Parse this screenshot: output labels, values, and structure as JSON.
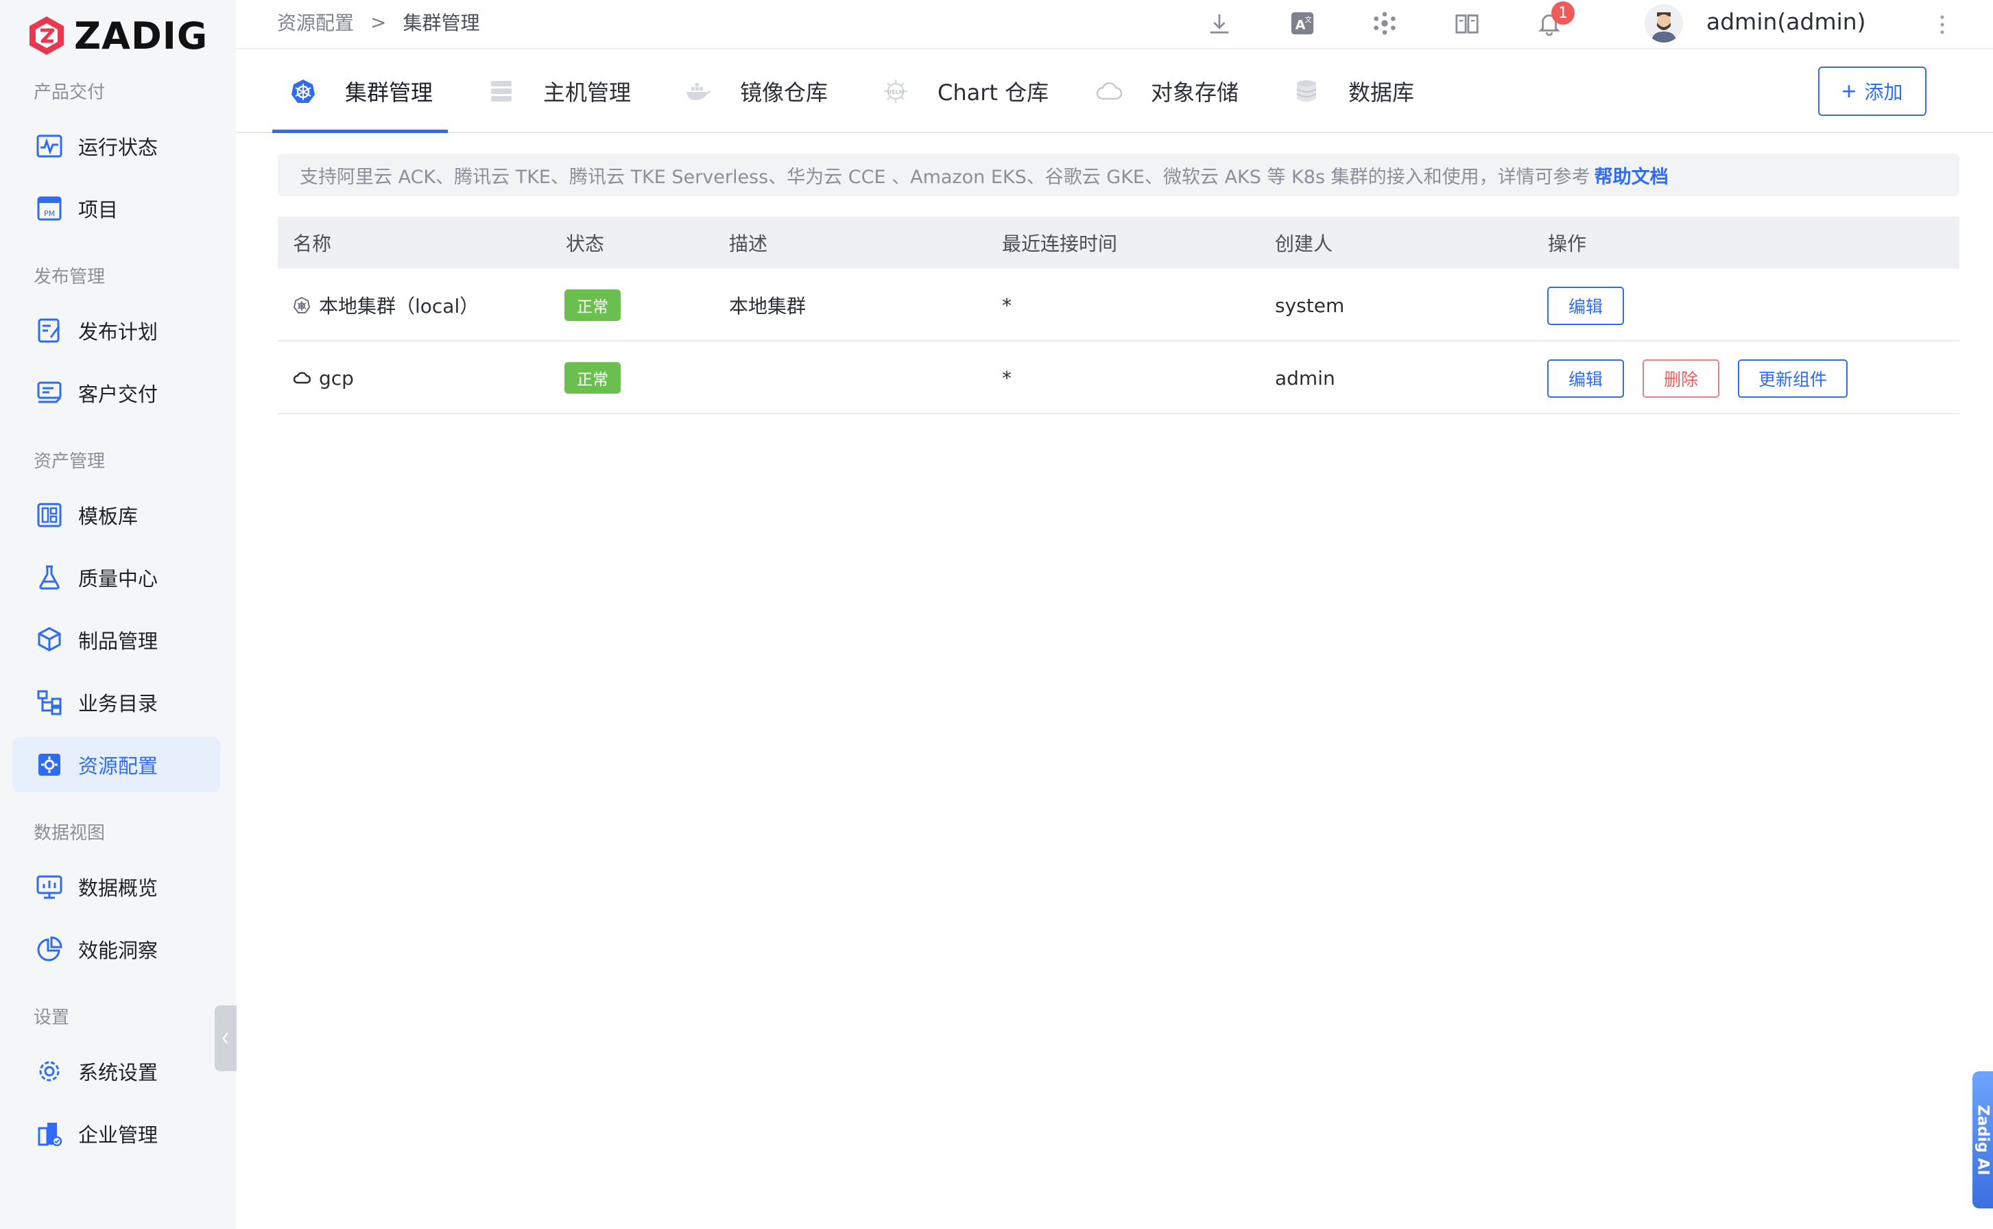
{
  "brand": {
    "name": "ZADIG"
  },
  "sidebar": {
    "sections": [
      {
        "label": "产品交付",
        "items": [
          {
            "label": "运行状态",
            "icon": "activity-monitor-icon"
          },
          {
            "label": "项目",
            "icon": "project-pm-icon"
          }
        ]
      },
      {
        "label": "发布管理",
        "items": [
          {
            "label": "发布计划",
            "icon": "release-plan-icon"
          },
          {
            "label": "客户交付",
            "icon": "customer-delivery-icon"
          }
        ]
      },
      {
        "label": "资产管理",
        "items": [
          {
            "label": "模板库",
            "icon": "template-library-icon"
          },
          {
            "label": "质量中心",
            "icon": "quality-flask-icon"
          },
          {
            "label": "制品管理",
            "icon": "artifact-package-icon"
          },
          {
            "label": "业务目录",
            "icon": "business-directory-icon"
          },
          {
            "label": "资源配置",
            "icon": "resource-config-icon"
          }
        ]
      },
      {
        "label": "数据视图",
        "items": [
          {
            "label": "数据概览",
            "icon": "data-overview-icon"
          },
          {
            "label": "效能洞察",
            "icon": "insight-pie-icon"
          }
        ]
      },
      {
        "label": "设置",
        "items": [
          {
            "label": "系统设置",
            "icon": "system-settings-icon"
          },
          {
            "label": "企业管理",
            "icon": "enterprise-icon"
          }
        ]
      }
    ],
    "active_item": "资源配置"
  },
  "header": {
    "breadcrumb": {
      "parent": "资源配置",
      "separator": ">",
      "current": "集群管理"
    },
    "notification_count": "1",
    "username": "admin(admin)"
  },
  "tabs": [
    {
      "label": "集群管理",
      "icon": "kubernetes-icon",
      "active": true
    },
    {
      "label": "主机管理",
      "icon": "server-icon",
      "active": false
    },
    {
      "label": "镜像仓库",
      "icon": "docker-icon",
      "active": false
    },
    {
      "label": "Chart 仓库",
      "icon": "helm-icon",
      "active": false
    },
    {
      "label": "对象存储",
      "icon": "cloud-storage-icon",
      "active": false
    },
    {
      "label": "数据库",
      "icon": "database-icon",
      "active": false
    }
  ],
  "add_button": {
    "label": "添加"
  },
  "notice": {
    "text": "支持阿里云 ACK、腾讯云 TKE、腾讯云 TKE Serverless、华为云 CCE 、Amazon EKS、谷歌云 GKE、微软云 AKS 等 K8s 集群的接入和使用，详情可参考",
    "link": "帮助文档"
  },
  "table": {
    "columns": [
      "名称",
      "状态",
      "描述",
      "最近连接时间",
      "创建人",
      "操作"
    ],
    "rows": [
      {
        "name": "本地集群（local）",
        "icon": "kubernetes-icon",
        "status": "正常",
        "description": "本地集群",
        "last_connected": "*",
        "creator": "system",
        "actions": [
          "编辑"
        ]
      },
      {
        "name": "gcp",
        "icon": "cloud-icon",
        "status": "正常",
        "description": "",
        "last_connected": "*",
        "creator": "admin",
        "actions": [
          "编辑",
          "删除",
          "更新组件"
        ]
      }
    ]
  },
  "ai_tab": {
    "label": "Zadig AI"
  },
  "colors": {
    "accent": "#2f6bf5",
    "status_ok": "#6bbf4e",
    "danger": "#f05a5a",
    "sidebar_bg": "#f5f6f8"
  }
}
